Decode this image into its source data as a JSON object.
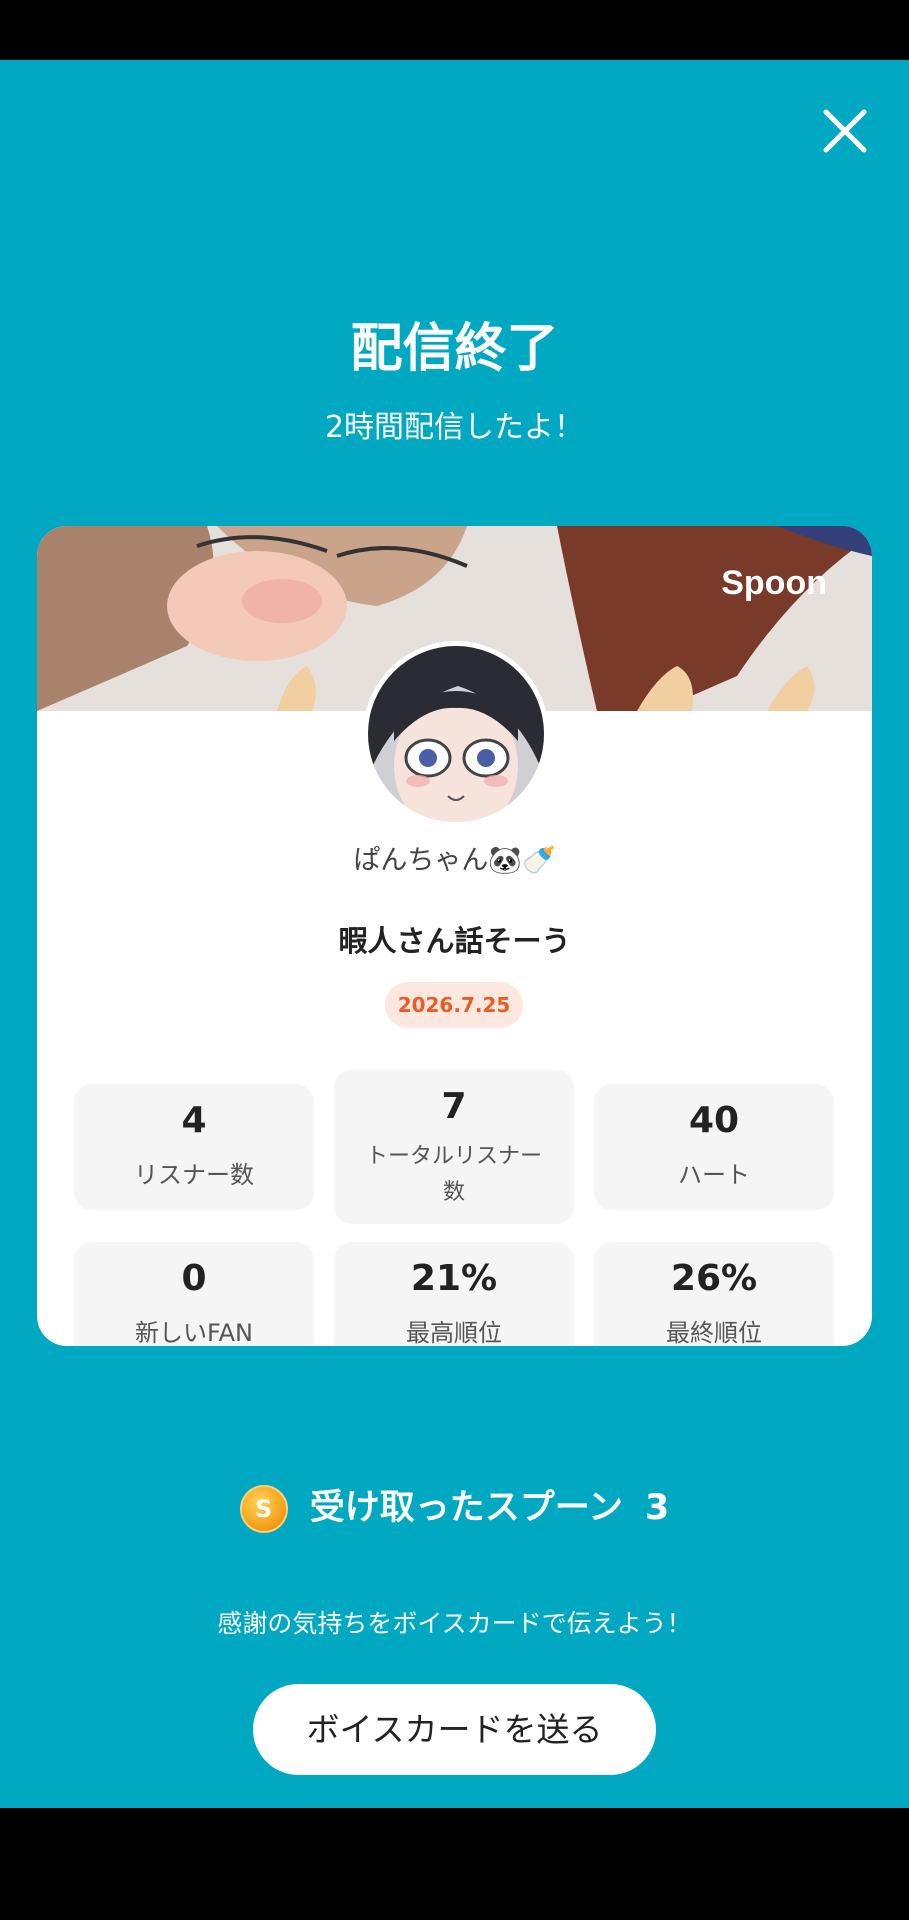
{
  "header": {
    "title": "配信終了",
    "subtitle": "2時間配信したよ！"
  },
  "card": {
    "brand": "Spoon",
    "username": "ぱんちゃん🐼🍼",
    "broadcast_title": "暇人さん話そーう",
    "date": "2026.7.25",
    "stats": [
      {
        "value": "4",
        "label": "リスナー数"
      },
      {
        "value": "7",
        "label_line1": "トータルリスナー",
        "label_line2": "数"
      },
      {
        "value": "40",
        "label": "ハート"
      },
      {
        "value": "0",
        "label": "新しいFAN"
      },
      {
        "value": "21%",
        "label": "最高順位"
      },
      {
        "value": "26%",
        "label": "最終順位"
      }
    ]
  },
  "spoons": {
    "coin_letter": "S",
    "label": "受け取ったスプーン",
    "count": "3"
  },
  "footer": {
    "thanks": "感謝の気持ちをボイスカードで伝えよう！",
    "button_label": "ボイスカードを送る"
  },
  "colors": {
    "background": "#00a8c2",
    "date_badge_bg": "#fde8e0",
    "date_badge_text": "#ee5a24"
  }
}
